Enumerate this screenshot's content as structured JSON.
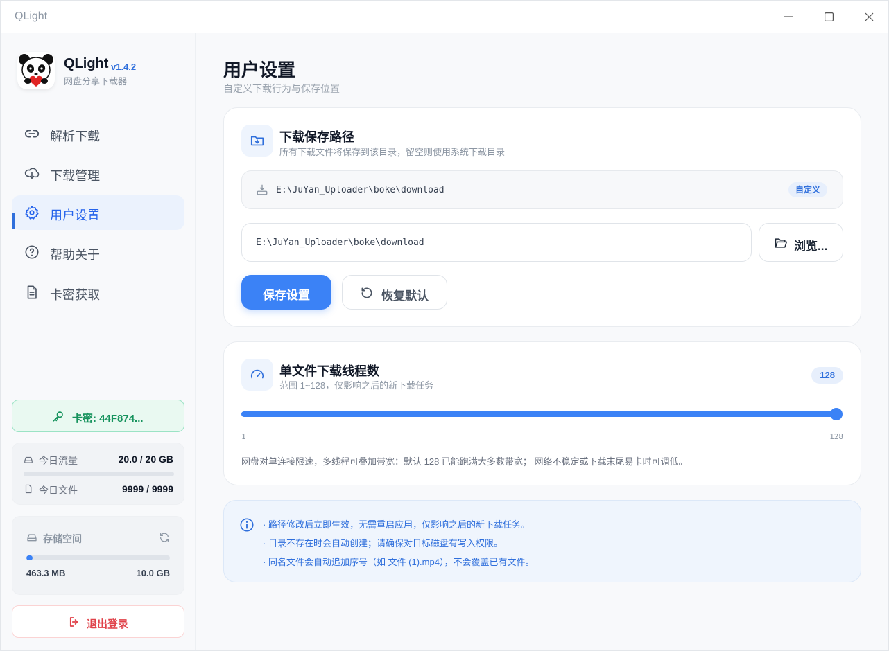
{
  "window": {
    "title": "QLight"
  },
  "brand": {
    "name": "QLight",
    "version": "v1.4.2",
    "subtitle": "网盘分享下载器"
  },
  "nav": [
    {
      "label": "解析下载",
      "icon": "link-icon"
    },
    {
      "label": "下载管理",
      "icon": "cloud-download-icon"
    },
    {
      "label": "用户设置",
      "icon": "gear-icon",
      "active": true
    },
    {
      "label": "帮助关于",
      "icon": "help-circle-icon"
    },
    {
      "label": "卡密获取",
      "icon": "document-icon"
    }
  ],
  "card_key": {
    "label": "卡密: 44F874..."
  },
  "quota": {
    "traffic_label": "今日流量",
    "traffic_value": "20.0 / 20 GB",
    "traffic_fraction": 1.0,
    "files_label": "今日文件",
    "files_value": "9999 / 9999"
  },
  "storage": {
    "title": "存储空间",
    "used": "463.3 MB",
    "total": "10.0 GB",
    "used_fraction": 0.045
  },
  "logout": {
    "label": "退出登录"
  },
  "page": {
    "title": "用户设置",
    "subtitle": "自定义下载行为与保存位置"
  },
  "path_panel": {
    "title": "下载保存路径",
    "subtitle": "所有下载文件将保存到该目录，留空则使用系统下载目录",
    "current_path": "E:\\JuYan_Uploader\\boke\\download",
    "badge": "自定义",
    "input_value": "E:\\JuYan_Uploader\\boke\\download",
    "browse_label": "浏览...",
    "save_label": "保存设置",
    "reset_label": "恢复默认"
  },
  "thread_panel": {
    "title": "单文件下载线程数",
    "subtitle": "范围 1~128，仅影响之后的新下载任务",
    "value": "128",
    "min": "1",
    "max": "128",
    "slider_fraction": 1.0,
    "note": "网盘对单连接限速，多线程可叠加带宽：默认 128 已能跑满大多数带宽； 网络不稳定或下载末尾易卡时可调低。"
  },
  "info": {
    "lines": [
      "· 路径修改后立即生效，无需重启应用，仅影响之后的新下载任务。",
      "· 目录不存在时会自动创建；请确保对目标磁盘有写入权限。",
      "· 同名文件会自动追加序号（如 文件 (1).mp4），不会覆盖已有文件。"
    ]
  },
  "colors": {
    "accent": "#3b82f6",
    "success": "#16935d",
    "danger": "#e0424a"
  }
}
